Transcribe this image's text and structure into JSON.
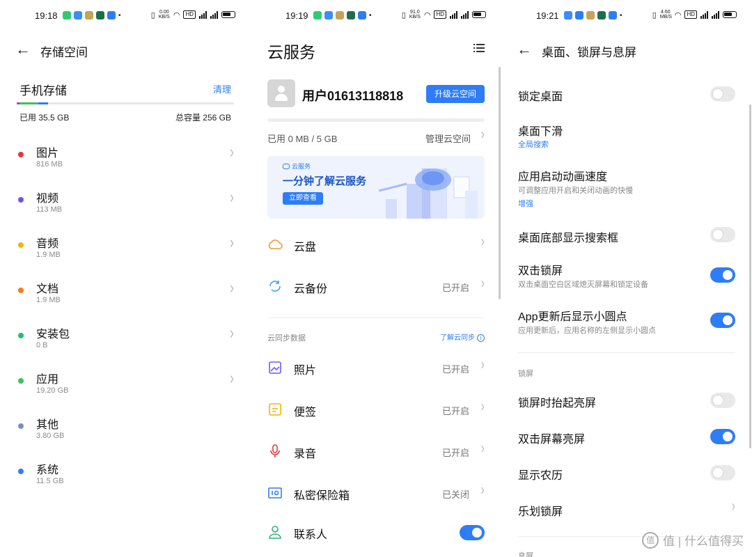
{
  "storage": {
    "status": {
      "time": "19:18",
      "net": "0.00\nKB/S"
    },
    "title": "存储空间",
    "section_title": "手机存储",
    "clean": "清理",
    "used": "已用 35.5 GB",
    "total": "总容量 256 GB",
    "categories": [
      {
        "name": "图片",
        "size": "816 MB",
        "color": "#e5383b"
      },
      {
        "name": "视频",
        "size": "113 MB",
        "color": "#7a4fe0"
      },
      {
        "name": "音频",
        "size": "1.9 MB",
        "color": "#f4b400"
      },
      {
        "name": "文档",
        "size": "1.9 MB",
        "color": "#f47b20"
      },
      {
        "name": "安装包",
        "size": "0 B",
        "color": "#1fbf6f"
      },
      {
        "name": "应用",
        "size": "19.20  GB",
        "color": "#3fc05a"
      },
      {
        "name": "其他",
        "size": "3.80 GB",
        "color": "#7a8fc0"
      },
      {
        "name": "系统",
        "size": "11.5 GB",
        "color": "#2e7df6"
      }
    ]
  },
  "cloud": {
    "status": {
      "time": "19:19",
      "net": "91.0\nKB/S"
    },
    "title": "云服务",
    "username": "用户01613118818",
    "upgrade": "升级云空间",
    "quota": "已用 0 MB / 5 GB",
    "manage": "管理云空间",
    "banner": {
      "logo": "云服务",
      "title": "一分钟了解云服务",
      "button": "立即查看"
    },
    "services": [
      {
        "name": "云盘",
        "status": ""
      },
      {
        "name": "云备份",
        "status": "已开启"
      }
    ],
    "sync_label": "云同步数据",
    "sync_link": "了解云同步",
    "sync_items": [
      {
        "name": "照片",
        "status": "已开启"
      },
      {
        "name": "便签",
        "status": "已开启"
      },
      {
        "name": "录音",
        "status": "已开启"
      },
      {
        "name": "私密保险箱",
        "status": "已关闭"
      },
      {
        "name": "联系人",
        "toggle": true
      }
    ]
  },
  "desktop": {
    "status": {
      "time": "19:21",
      "net": "4.60\nMB/S"
    },
    "title": "桌面、锁屏与息屏",
    "settings": [
      {
        "name": "锁定桌面",
        "toggle": false
      },
      {
        "name": "桌面下滑",
        "link": "全局搜索"
      },
      {
        "name": "应用启动动画速度",
        "sub": "可调整应用开启和关闭动画的快慢",
        "link": "增强"
      },
      {
        "name": "桌面底部显示搜索框",
        "toggle": false
      },
      {
        "name": "双击锁屏",
        "sub": "双击桌面空白区域熄灭屏幕和锁定设备",
        "toggle": true
      },
      {
        "name": "App更新后显示小圆点",
        "sub": "应用更新后，应用名称的左侧显示小圆点",
        "toggle": true
      }
    ],
    "lock_section": "锁屏",
    "lock_settings": [
      {
        "name": "锁屏时抬起亮屏",
        "toggle": false
      },
      {
        "name": "双击屏幕亮屏",
        "toggle": true
      },
      {
        "name": "显示农历",
        "toggle": false
      },
      {
        "name": "乐划锁屏"
      }
    ],
    "next_section": "息屏"
  },
  "watermark": "值 | 什么值得买",
  "colors": {
    "accent": "#2e7df6"
  }
}
